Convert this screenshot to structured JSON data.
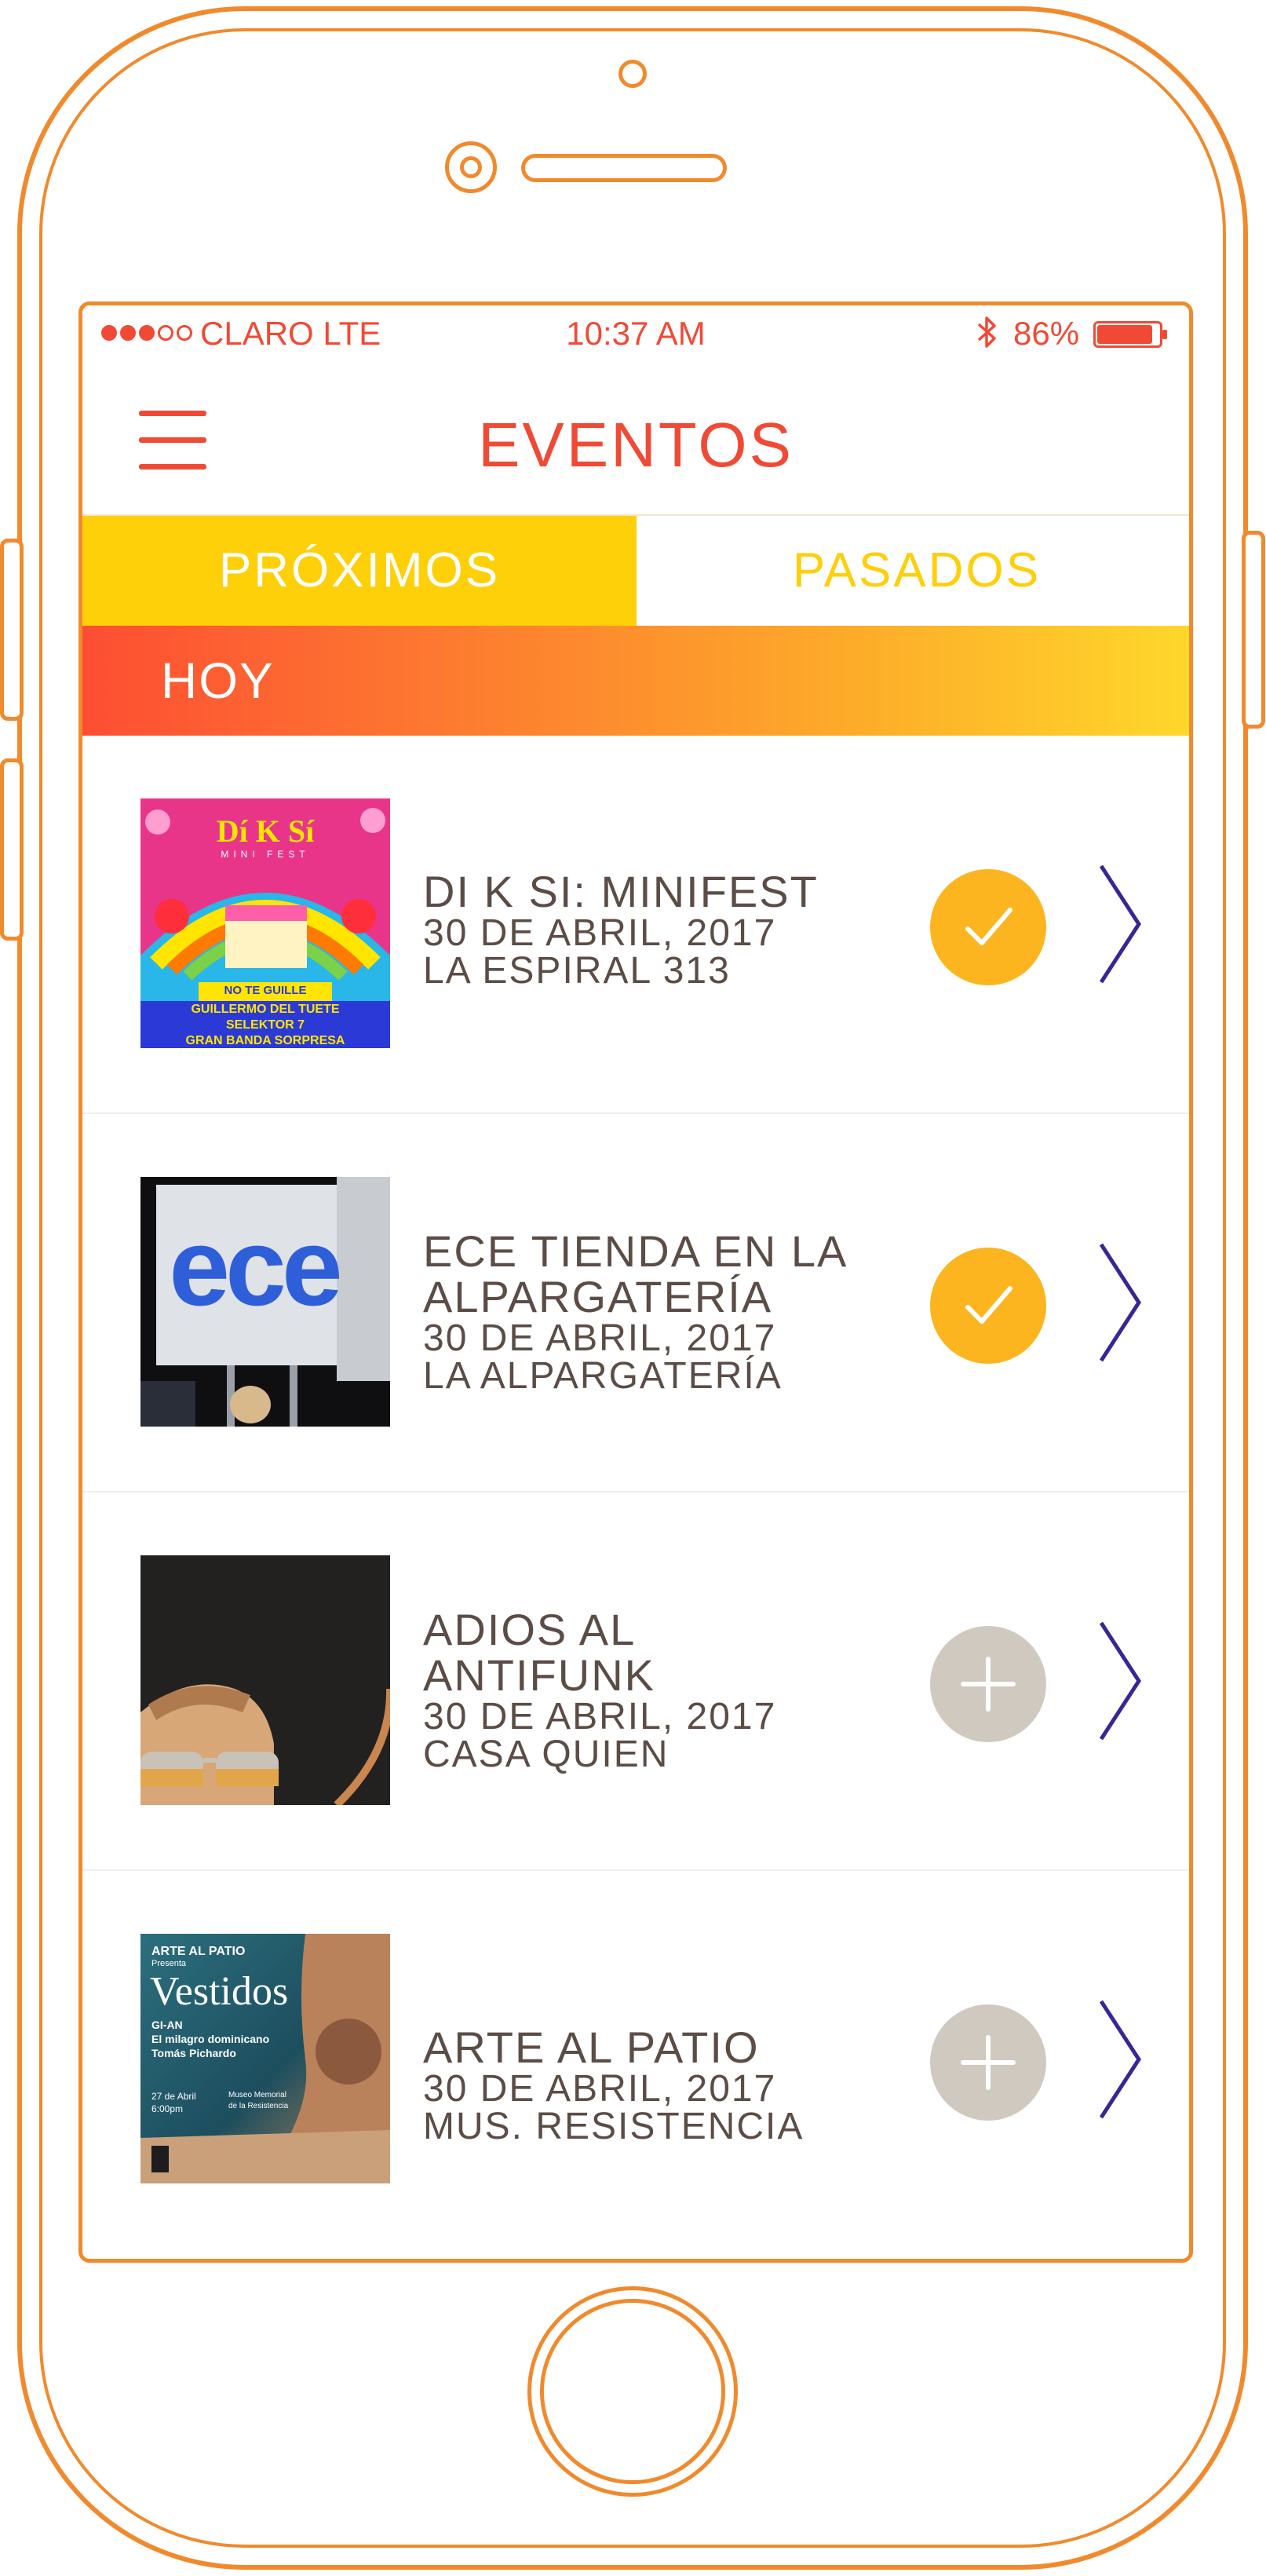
{
  "status_bar": {
    "carrier": "CLARO LTE",
    "time": "10:37 AM",
    "battery": "86%",
    "bluetooth_icon": "bluetooth-icon",
    "color": "#f04a36"
  },
  "header": {
    "title": "EVENTOS",
    "menu_icon": "hamburger-menu-icon"
  },
  "tabs": [
    {
      "label": "PRÓXIMOS",
      "active": true
    },
    {
      "label": "PASADOS",
      "active": false
    }
  ],
  "section": {
    "label": "HOY"
  },
  "events": [
    {
      "title": "DI K SI: MINIFEST",
      "date": "30 DE ABRIL, 2017",
      "venue": "LA ESPIRAL 313",
      "status": "attending",
      "poster": {
        "heading": "Dí K Sí",
        "subheading": "MINI FEST",
        "banner": "NO TE GUILLE",
        "lines": [
          "GUILLERMO DEL TUETE",
          "SELEKTOR 7",
          "GRAN BANDA SORPRESA"
        ]
      }
    },
    {
      "title_lines": [
        "ECE TIENDA EN LA",
        "ALPARGATERÍA"
      ],
      "date": "30 DE ABRIL, 2017",
      "venue": "LA ALPARGATERÍA",
      "status": "attending",
      "poster": {
        "heading": "ece"
      }
    },
    {
      "title_lines": [
        "ADIOS AL",
        "ANTIFUNK"
      ],
      "date": "30 DE ABRIL, 2017",
      "venue": "CASA QUIEN",
      "status": "not_attending"
    },
    {
      "title": "ARTE AL PATIO",
      "date": "30 DE ABRIL, 2017",
      "venue": "MUS. RESISTENCIA",
      "status": "not_attending",
      "poster": {
        "top": "ARTE AL PATIO",
        "presenta": "Presenta",
        "heading": "Vestidos",
        "lines": [
          "GI-AN",
          "El milagro dominicano",
          "Tomás Pichardo"
        ],
        "date": "27 de Abril",
        "time": "6:00pm",
        "place_lines": [
          "Museo Memorial",
          "de la Resistencia"
        ]
      }
    }
  ],
  "colors": {
    "accent": "#f04a36",
    "frame": "#f08a2c",
    "tab_active": "#fed009",
    "check": "#fdb51f",
    "add": "#d0c9c0",
    "chevron": "#3b2595",
    "text": "#5b4d46"
  }
}
